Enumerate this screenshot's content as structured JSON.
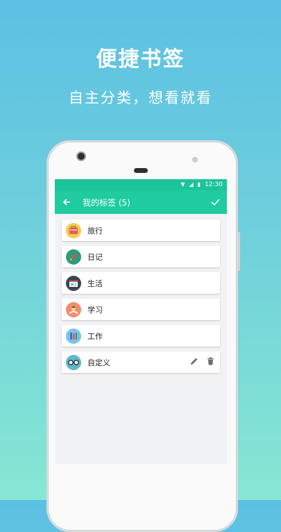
{
  "promo": {
    "title": "便捷书签",
    "subtitle": "自主分类，想看就看"
  },
  "statusbar": {
    "time": "12:30",
    "icons": [
      "wifi-icon",
      "signal-icon",
      "battery-icon"
    ]
  },
  "toolbar": {
    "back_icon": "back-arrow-icon",
    "title": "我的标签 (5)",
    "confirm_icon": "check-icon"
  },
  "colors": {
    "accent": "#1fcb9f",
    "status_bar": "#1cc49a",
    "bg_top": "#5cc0e3",
    "bg_bottom": "#86e7d3"
  },
  "tags": [
    {
      "label": "旅行",
      "icon": "travel-bag-icon",
      "color": "#f6c94a"
    },
    {
      "label": "日记",
      "icon": "pencil-diary-icon",
      "color": "#2f9a78"
    },
    {
      "label": "生活",
      "icon": "browser-window-icon",
      "color": "#3d4753"
    },
    {
      "label": "学习",
      "icon": "student-reading-icon",
      "color": "#f08f6a"
    },
    {
      "label": "工作",
      "icon": "folders-icon",
      "color": "#7cc3e8"
    },
    {
      "label": "自定义",
      "icon": "glasses-icon",
      "color": "#5fb8c9",
      "edit_icon": "edit-pencil-icon",
      "delete_icon": "trash-icon"
    }
  ]
}
